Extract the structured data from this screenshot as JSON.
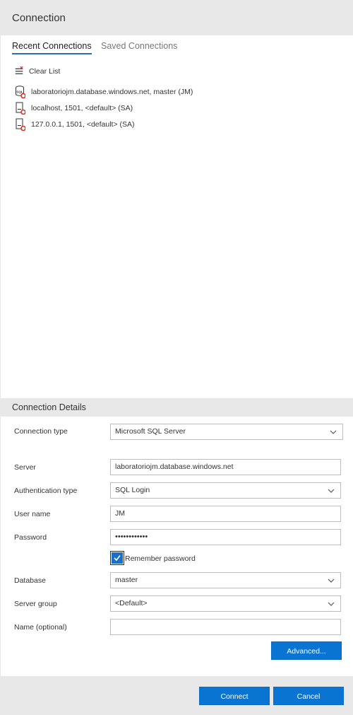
{
  "header": {
    "title": "Connection"
  },
  "tabs": {
    "recent": "Recent Connections",
    "saved": "Saved Connections"
  },
  "recent": {
    "clear_label": "Clear List",
    "items": [
      {
        "label": "laboratoriojm.database.windows.net, master (JM)",
        "icon": "sql-database-icon"
      },
      {
        "label": "localhost, 1501, <default> (SA)",
        "icon": "server-icon"
      },
      {
        "label": "127.0.0.1, 1501, <default> (SA)",
        "icon": "server-icon"
      }
    ]
  },
  "details": {
    "title": "Connection Details",
    "connection_type_label": "Connection type",
    "connection_type_value": "Microsoft SQL Server",
    "server_label": "Server",
    "server_value": "laboratoriojm.database.windows.net",
    "auth_label": "Authentication type",
    "auth_value": "SQL Login",
    "username_label": "User name",
    "username_value": "JM",
    "password_label": "Password",
    "password_value": "••••••••••••",
    "remember_label": "Remember password",
    "remember_checked": true,
    "database_label": "Database",
    "database_value": "master",
    "server_group_label": "Server group",
    "server_group_value": "<Default>",
    "name_label": "Name (optional)",
    "name_value": "",
    "advanced_label": "Advanced..."
  },
  "footer": {
    "connect_label": "Connect",
    "cancel_label": "Cancel"
  },
  "colors": {
    "accent": "#0a74d2",
    "header_bg": "#e8e8e8",
    "error_badge": "#d93025"
  }
}
